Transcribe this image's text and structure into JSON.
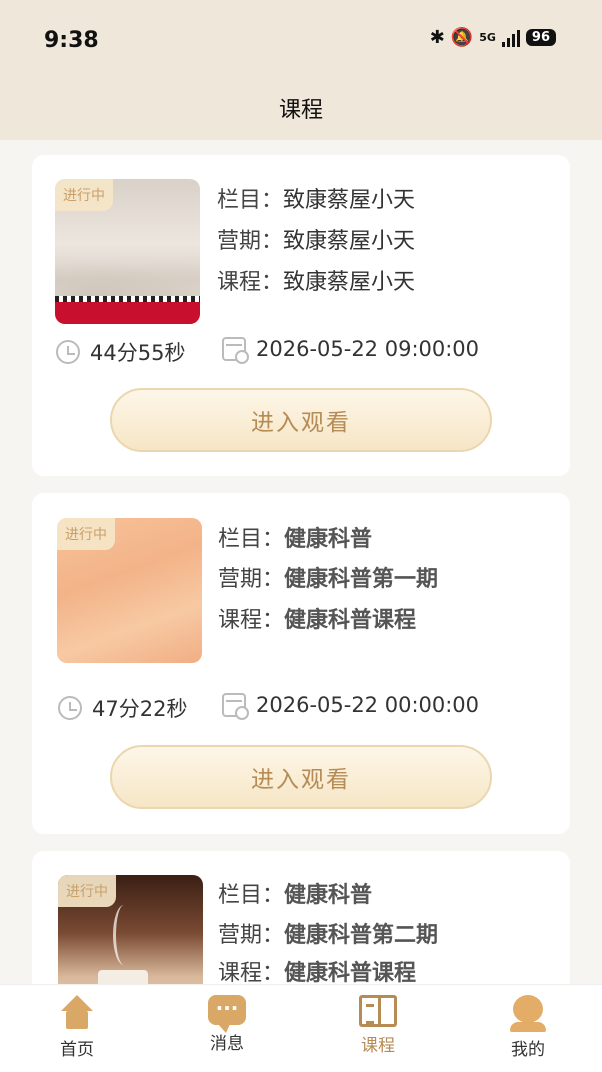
{
  "status": {
    "time": "9:38",
    "network": "5G",
    "battery": "96"
  },
  "header": {
    "title": "课程"
  },
  "cards": [
    {
      "badge": "进行中",
      "column_label": "栏目：",
      "column": "致康蔡屋小天",
      "period_label": "营期：",
      "period": "致康蔡屋小天",
      "course_label": "课程：",
      "course": "致康蔡屋小天",
      "duration": "44分55秒",
      "datetime": "2026-05-22 09:00:00",
      "button": "进入观看"
    },
    {
      "badge": "进行中",
      "column_label": "栏目：",
      "column": "健康科普",
      "period_label": "营期：",
      "period": "健康科普第一期",
      "course_label": "课程：",
      "course": "健康科普课程",
      "duration": "47分22秒",
      "datetime": "2026-05-22 00:00:00",
      "button": "进入观看"
    },
    {
      "badge": "进行中",
      "column_label": "栏目：",
      "column": "健康科普",
      "period_label": "营期：",
      "period": "健康科普第二期",
      "course_label": "课程：",
      "course": "健康科普课程"
    }
  ],
  "tabs": [
    {
      "label": "首页",
      "icon": "home-icon"
    },
    {
      "label": "消息",
      "icon": "message-icon"
    },
    {
      "label": "课程",
      "icon": "course-book-icon",
      "active": true
    },
    {
      "label": "我的",
      "icon": "profile-icon"
    }
  ],
  "colors": {
    "accent": "#b68b54",
    "header_bg": "#efe7d9",
    "icon": "#d9a766"
  }
}
